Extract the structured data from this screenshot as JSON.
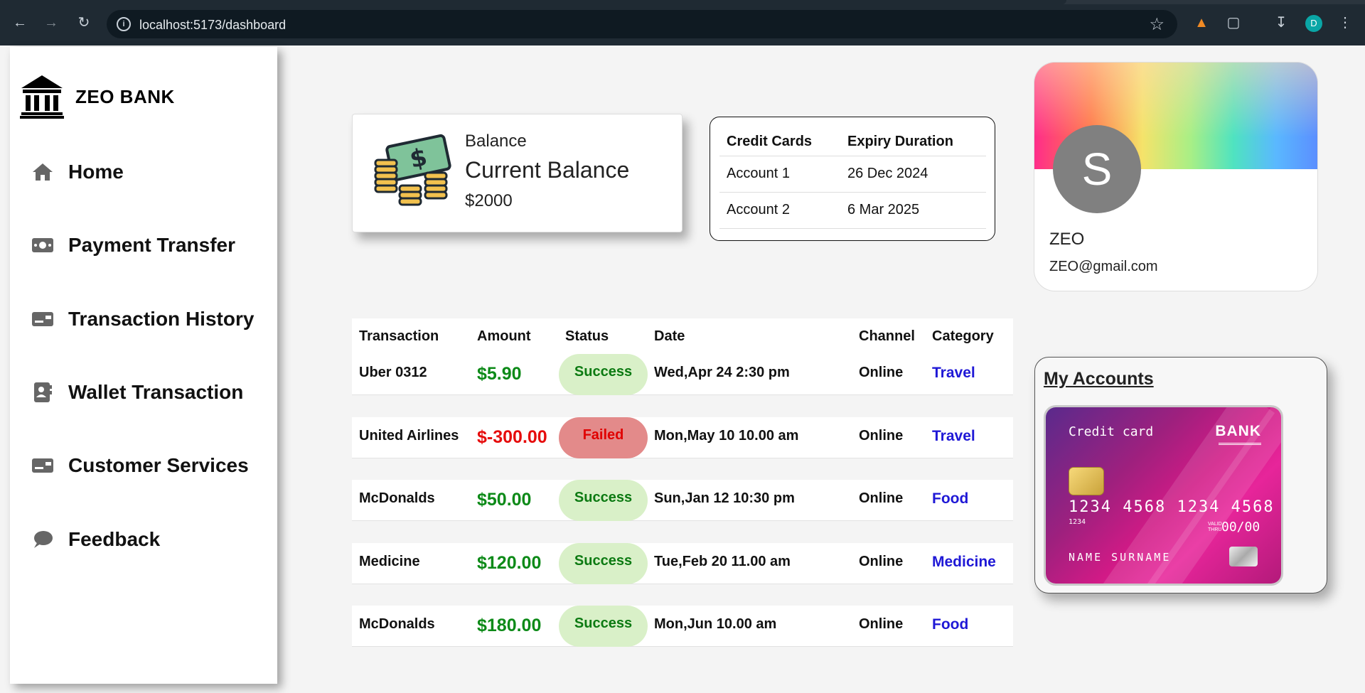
{
  "browser": {
    "url": "localhost:5173/dashboard",
    "profile_initial": "D"
  },
  "sidebar": {
    "brand": "ZEO BANK",
    "items": [
      {
        "label": "Home",
        "icon": "home-icon"
      },
      {
        "label": "Payment Transfer",
        "icon": "money-icon"
      },
      {
        "label": "Transaction History",
        "icon": "card-icon"
      },
      {
        "label": "Wallet Transaction",
        "icon": "contact-book-icon"
      },
      {
        "label": "Customer Services",
        "icon": "card-icon"
      },
      {
        "label": "Feedback",
        "icon": "chat-bubble-icon"
      }
    ]
  },
  "balance": {
    "label": "Balance",
    "title": "Current Balance",
    "amount": "$2000"
  },
  "credit_cards": {
    "headers": [
      "Credit Cards",
      "Expiry Duration"
    ],
    "rows": [
      [
        "Account 1",
        "26 Dec 2024"
      ],
      [
        "Account 2",
        "6 Mar 2025"
      ]
    ]
  },
  "profile": {
    "initial": "S",
    "name": "ZEO",
    "email": "ZEO@gmail.com"
  },
  "transactions": {
    "headers": [
      "Transaction",
      "Amount",
      "Status",
      "Date",
      "Channel",
      "Category"
    ],
    "rows": [
      {
        "name": "Uber 0312",
        "amount": "$5.90",
        "status": "Success",
        "date": "Wed,Apr 24 2:30 pm",
        "channel": "Online",
        "category": "Travel"
      },
      {
        "name": "United Airlines",
        "amount": "$-300.00",
        "status": "Failed",
        "date": "Mon,May 10 10.00 am",
        "channel": "Online",
        "category": "Travel"
      },
      {
        "name": "McDonalds",
        "amount": "$50.00",
        "status": "Success",
        "date": "Sun,Jan 12 10:30 pm",
        "channel": "Online",
        "category": "Food"
      },
      {
        "name": "Medicine",
        "amount": "$120.00",
        "status": "Success",
        "date": "Tue,Feb 20 11.00 am",
        "channel": "Online",
        "category": "Medicine"
      },
      {
        "name": "McDonalds",
        "amount": "$180.00",
        "status": "Success",
        "date": "Mon,Jun 10.00 am",
        "channel": "Online",
        "category": "Food"
      }
    ]
  },
  "accounts": {
    "title": "My Accounts",
    "card": {
      "type": "Credit card",
      "bank": "BANK",
      "number": "1234  4568 1234  4568",
      "small_number": "1234",
      "valid_label": "VALID THRU",
      "expiry": "00/00",
      "holder": "NAME SURNAME"
    }
  },
  "colors": {
    "success_bg": "#d9f0c8",
    "success_text": "#0c7a12",
    "failed_bg": "#e38a8a",
    "failed_text": "#e00000",
    "category_text": "#1f18d6",
    "positive_amount": "#0d8a18",
    "negative_amount": "#e60c0c"
  }
}
